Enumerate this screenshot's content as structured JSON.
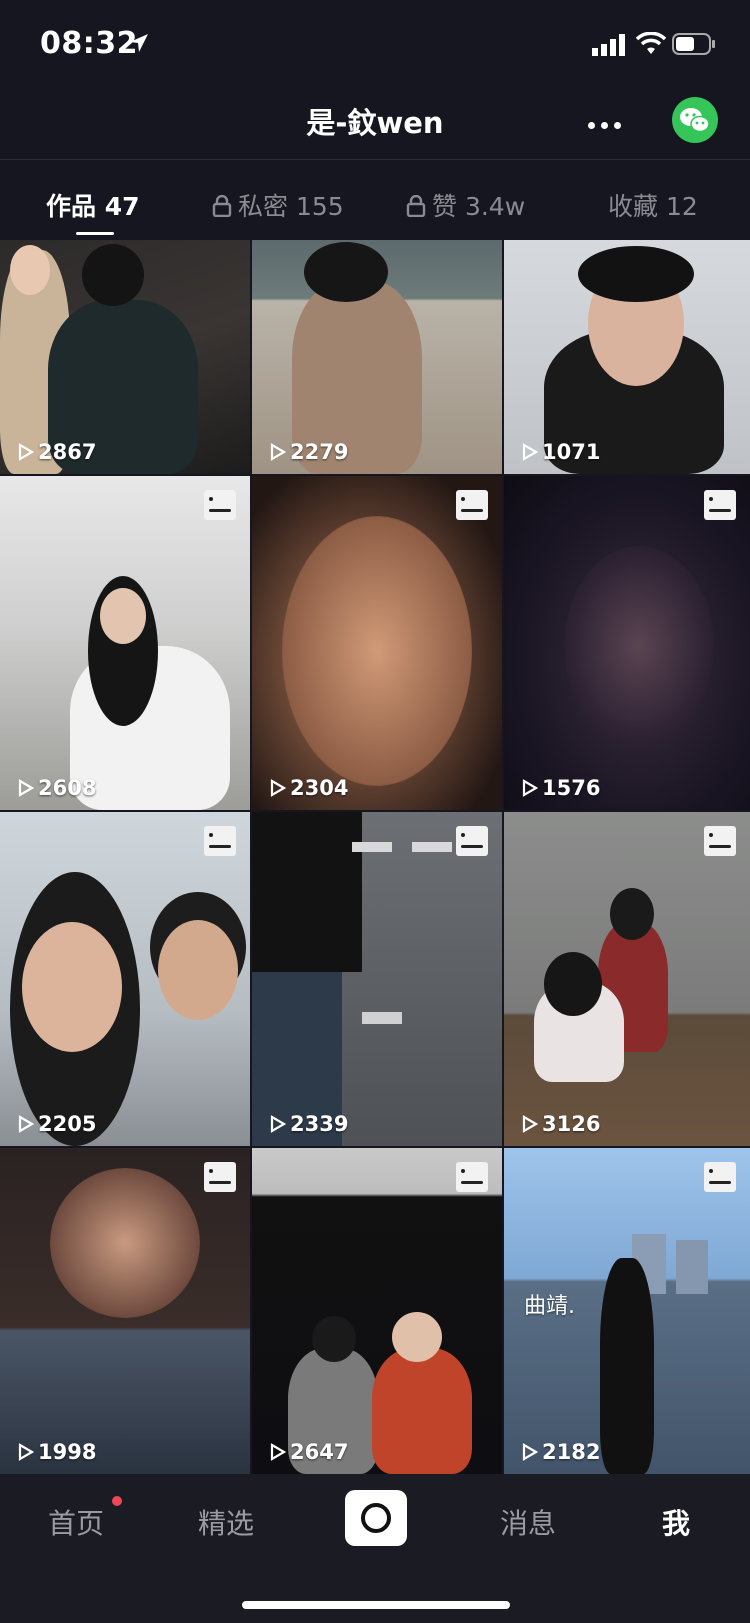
{
  "status_bar": {
    "time": "08:32"
  },
  "header": {
    "title": "是-鈫wen",
    "more_icon": "more-dots-icon",
    "share_icon": "wechat-icon",
    "share_color": "#35c558"
  },
  "tabs": [
    {
      "label": "作品 47",
      "locked": false,
      "active": true
    },
    {
      "label": "私密 155",
      "locked": true,
      "active": false
    },
    {
      "label": "赞 3.4w",
      "locked": true,
      "active": false
    },
    {
      "label": "收藏 12",
      "locked": false,
      "active": false
    }
  ],
  "grid": {
    "items": [
      {
        "views": "2867",
        "multi_image": false
      },
      {
        "views": "2279",
        "multi_image": false
      },
      {
        "views": "1071",
        "multi_image": false
      },
      {
        "views": "2608",
        "multi_image": true
      },
      {
        "views": "2304",
        "multi_image": true
      },
      {
        "views": "1576",
        "multi_image": true
      },
      {
        "views": "2205",
        "multi_image": true
      },
      {
        "views": "2339",
        "multi_image": true
      },
      {
        "views": "3126",
        "multi_image": true
      },
      {
        "views": "1998",
        "multi_image": true
      },
      {
        "views": "2647",
        "multi_image": true
      },
      {
        "views": "2182",
        "multi_image": true,
        "caption": "曲靖."
      }
    ]
  },
  "bottom_nav": {
    "items": [
      {
        "label": "首页",
        "badge": true
      },
      {
        "label": "精选"
      },
      {
        "label": "消息"
      },
      {
        "label": "我",
        "active": true
      }
    ],
    "camera_icon": "camera-icon"
  }
}
